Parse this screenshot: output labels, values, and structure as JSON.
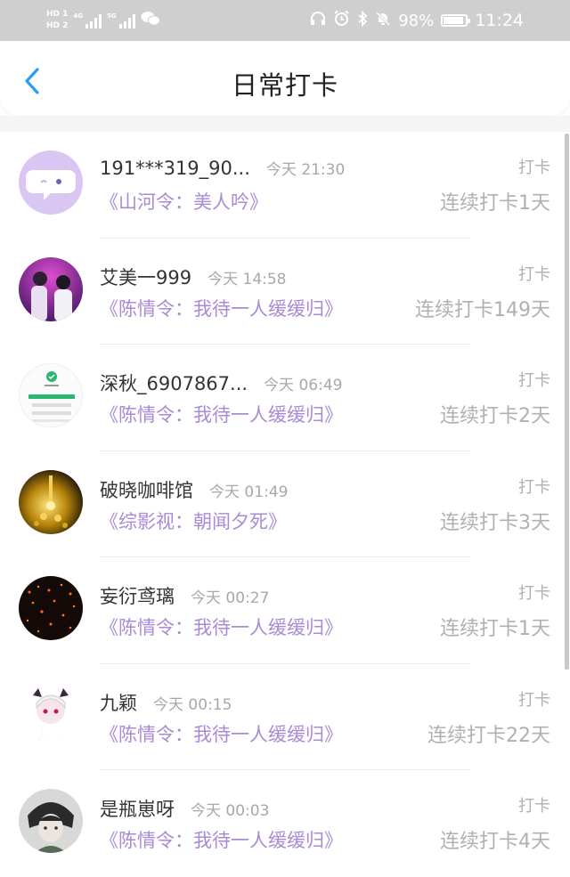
{
  "status_bar": {
    "hd1": "HD 1",
    "hd2": "HD 2",
    "net1": "4G",
    "net2": "5G",
    "battery": "98%",
    "time": "11:24"
  },
  "header": {
    "title": "日常打卡"
  },
  "colors": {
    "accent": "#2a9df4",
    "book_purple": "#a98ad6",
    "muted": "#b0b0b0"
  },
  "entries": [
    {
      "name": "191***319_90...",
      "time": "今天 21:30",
      "action": "打卡",
      "book": "《山河令：美人吟》",
      "streak": "连续打卡1天"
    },
    {
      "name": "艾美一999",
      "time": "今天 14:58",
      "action": "打卡",
      "book": "《陈情令：我待一人缓缓归》",
      "streak": "连续打卡149天"
    },
    {
      "name": "深秋_6907867...",
      "time": "今天 06:49",
      "action": "打卡",
      "book": "《陈情令：我待一人缓缓归》",
      "streak": "连续打卡2天"
    },
    {
      "name": "破晓咖啡馆",
      "time": "今天 01:49",
      "action": "打卡",
      "book": "《综影视：朝闻夕死》",
      "streak": "连续打卡3天"
    },
    {
      "name": "妄衍鸢璃",
      "time": "今天 00:27",
      "action": "打卡",
      "book": "《陈情令：我待一人缓缓归》",
      "streak": "连续打卡1天"
    },
    {
      "name": "九颖",
      "time": "今天 00:15",
      "action": "打卡",
      "book": "《陈情令：我待一人缓缓归》",
      "streak": "连续打卡22天"
    },
    {
      "name": "是瓶崽呀",
      "time": "今天 00:03",
      "action": "打卡",
      "book": "《陈情令：我待一人缓缓归》",
      "streak": "连续打卡4天"
    }
  ],
  "avatar_texts": {
    "row6": "九颖"
  }
}
